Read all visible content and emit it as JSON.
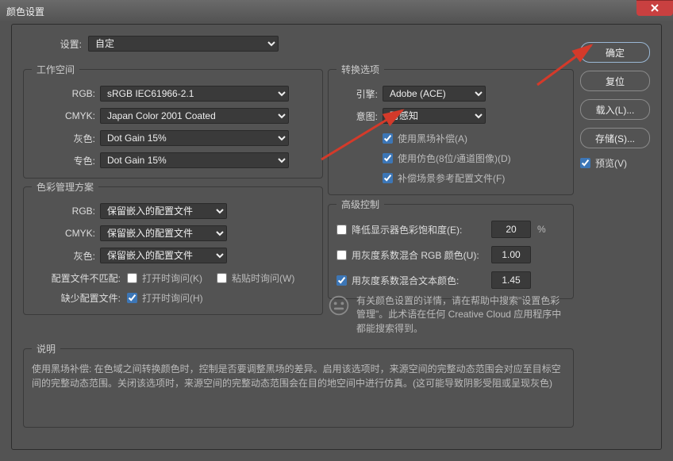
{
  "window": {
    "title": "颜色设置"
  },
  "settings": {
    "label": "设置:",
    "value": "自定"
  },
  "workspace": {
    "legend": "工作空间",
    "rgb_label": "RGB:",
    "rgb_value": "sRGB IEC61966-2.1",
    "cmyk_label": "CMYK:",
    "cmyk_value": "Japan Color 2001 Coated",
    "gray_label": "灰色:",
    "gray_value": "Dot Gain 15%",
    "spot_label": "专色:",
    "spot_value": "Dot Gain 15%"
  },
  "policies": {
    "legend": "色彩管理方案",
    "rgb_label": "RGB:",
    "rgb_value": "保留嵌入的配置文件",
    "cmyk_label": "CMYK:",
    "cmyk_value": "保留嵌入的配置文件",
    "gray_label": "灰色:",
    "gray_value": "保留嵌入的配置文件",
    "mismatch_label": "配置文件不匹配:",
    "ask_open": "打开时询问(K)",
    "ask_paste": "粘贴时询问(W)",
    "missing_label": "缺少配置文件:",
    "ask_open_missing": "打开时询问(H)"
  },
  "conversion": {
    "legend": "转换选项",
    "engine_label": "引擎:",
    "engine_value": "Adobe (ACE)",
    "intent_label": "意图:",
    "intent_value": "可感知",
    "black_point": "使用黑场补偿(A)",
    "dither": "使用仿色(8位/通道图像)(D)",
    "compensate": "补偿场景参考配置文件(F)"
  },
  "advanced": {
    "legend": "高级控制",
    "desaturate_label": "降低显示器色彩饱和度(E):",
    "desaturate_value": "20",
    "desaturate_unit": "%",
    "blend_rgb_label": "用灰度系数混合 RGB 颜色(U):",
    "blend_rgb_value": "1.00",
    "blend_text_label": "用灰度系数混合文本颜色:",
    "blend_text_value": "1.45"
  },
  "info_hint": "有关颜色设置的详情，请在帮助中搜索\"设置色彩管理\"。此术语在任何 Creative Cloud 应用程序中都能搜索得到。",
  "description": {
    "legend": "说明",
    "text": "使用黑场补偿: 在色域之间转换颜色时，控制是否要调整黑场的差异。启用该选项时，来源空间的完整动态范围会对应至目标空间的完整动态范围。关闭该选项时，来源空间的完整动态范围会在目的地空间中进行仿真。(这可能导致阴影受阻或呈现灰色)"
  },
  "buttons": {
    "ok": "确定",
    "reset": "复位",
    "load": "载入(L)...",
    "save": "存储(S)...",
    "preview": "预览(V)"
  }
}
